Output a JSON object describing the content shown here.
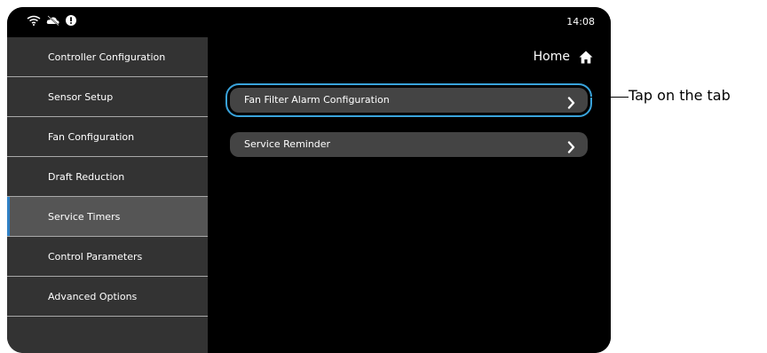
{
  "statusbar": {
    "time": "14:08",
    "icons": [
      "wifi-icon",
      "cloud-off-icon",
      "alert-icon"
    ]
  },
  "sidebar": {
    "items": [
      {
        "label": "Controller Configuration"
      },
      {
        "label": "Sensor Setup"
      },
      {
        "label": "Fan Configuration"
      },
      {
        "label": "Draft Reduction"
      },
      {
        "label": "Service Timers",
        "active": true
      },
      {
        "label": "Control Parameters"
      },
      {
        "label": "Advanced Options"
      }
    ]
  },
  "header": {
    "home_label": "Home"
  },
  "main": {
    "rows": [
      {
        "label": "Fan Filter Alarm Configuration"
      },
      {
        "label": "Service Reminder"
      }
    ]
  },
  "annotation": {
    "text": "Tap on the tab"
  },
  "colors": {
    "highlight": "#39a3db",
    "active_indicator": "#2f80c4"
  }
}
